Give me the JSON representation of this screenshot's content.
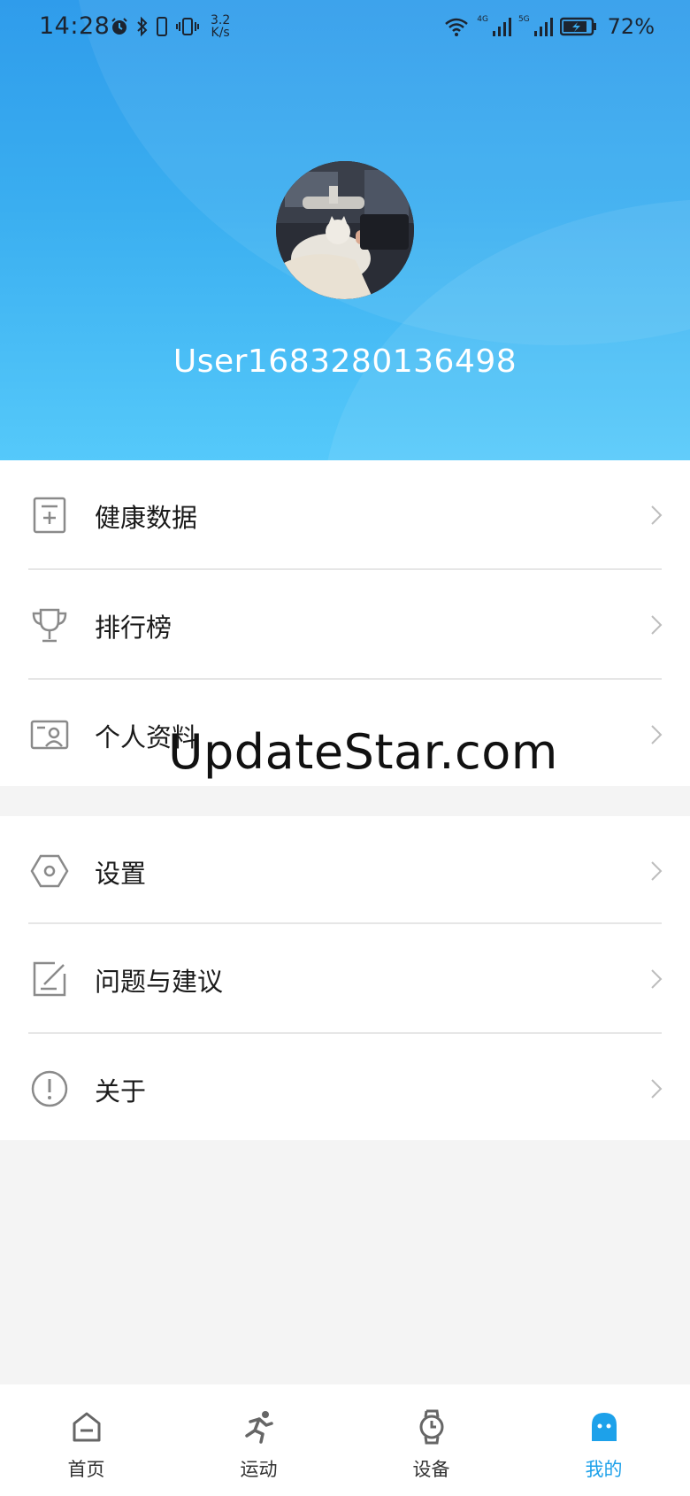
{
  "status_bar": {
    "time": "14:28",
    "net_speed_value": "3.2",
    "net_speed_unit": "K/s",
    "sig1_label": "4G",
    "sig2_label": "5G",
    "battery": "72%"
  },
  "profile": {
    "username": "User1683280136498"
  },
  "menu_group1": [
    {
      "label": "健康数据",
      "icon": "health-data-icon"
    },
    {
      "label": "排行榜",
      "icon": "trophy-icon"
    },
    {
      "label": "个人资料",
      "icon": "profile-card-icon"
    }
  ],
  "menu_group2": [
    {
      "label": "设置",
      "icon": "settings-hexagon-icon"
    },
    {
      "label": "问题与建议",
      "icon": "feedback-edit-icon"
    },
    {
      "label": "关于",
      "icon": "info-exclamation-icon"
    }
  ],
  "watermark": "UpdateStar.com",
  "tabs": [
    {
      "label": "首页",
      "icon": "home-icon"
    },
    {
      "label": "运动",
      "icon": "running-icon"
    },
    {
      "label": "设备",
      "icon": "watch-icon"
    },
    {
      "label": "我的",
      "icon": "user-face-icon"
    }
  ],
  "colors": {
    "accent": "#1da1ea",
    "header_top": "#2f9ceb",
    "header_bottom": "#55c9fa"
  }
}
